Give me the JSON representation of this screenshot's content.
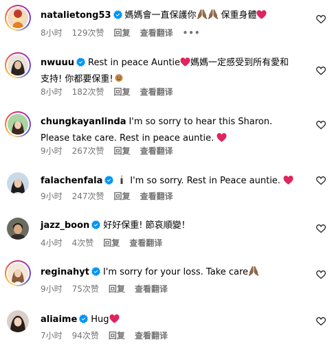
{
  "comments": [
    {
      "username": "natalietong53",
      "text_before": "媽媽會一直保護你",
      "text_middle": "保重身體",
      "time": "8小时",
      "likes": "129次赞",
      "reply": "回复",
      "translate": "查看翻译",
      "more": "•••"
    },
    {
      "username": "nwuuu",
      "text_before": "Rest in peace Auntie",
      "text_after": "媽媽一定感受到所有愛和支持! 你都要保重!",
      "time": "8小时",
      "likes": "182次赞",
      "reply": "回复",
      "translate": "查看翻译"
    },
    {
      "username": "chungkayanlinda",
      "text_before": "I'm so sorry to hear this Sharon. Please take care. Rest in peace auntie.",
      "time": "9小时",
      "likes": "267次赞",
      "reply": "回复",
      "translate": "查看翻译"
    },
    {
      "username": "falachenfala",
      "text_before": "I'm so sorry. Rest in Peace auntie.",
      "time": "9小时",
      "likes": "247次赞",
      "reply": "回复",
      "translate": "查看翻译"
    },
    {
      "username": "jazz_boon",
      "text_before": "好好保重! 節哀順變！",
      "time": "4小时",
      "likes": "4次赞",
      "reply": "回复",
      "translate": "查看翻译"
    },
    {
      "username": "reginahyt",
      "text_before": "I'm sorry for your loss. Take care",
      "time": "9小时",
      "likes": "75次赞",
      "reply": "回复",
      "translate": "查看翻译"
    },
    {
      "username": "aliaime",
      "text_before": "Hug",
      "time": "7小时",
      "likes": "94次赞",
      "reply": "回复",
      "translate": "查看翻译"
    }
  ],
  "colors": {
    "verified": "#0095f6",
    "heart_emoji": "#e0245e",
    "meta_text": "#737373"
  },
  "icons": {
    "like": "heart-outline-icon",
    "verified": "verified-badge-icon",
    "more": "more-options-icon"
  }
}
